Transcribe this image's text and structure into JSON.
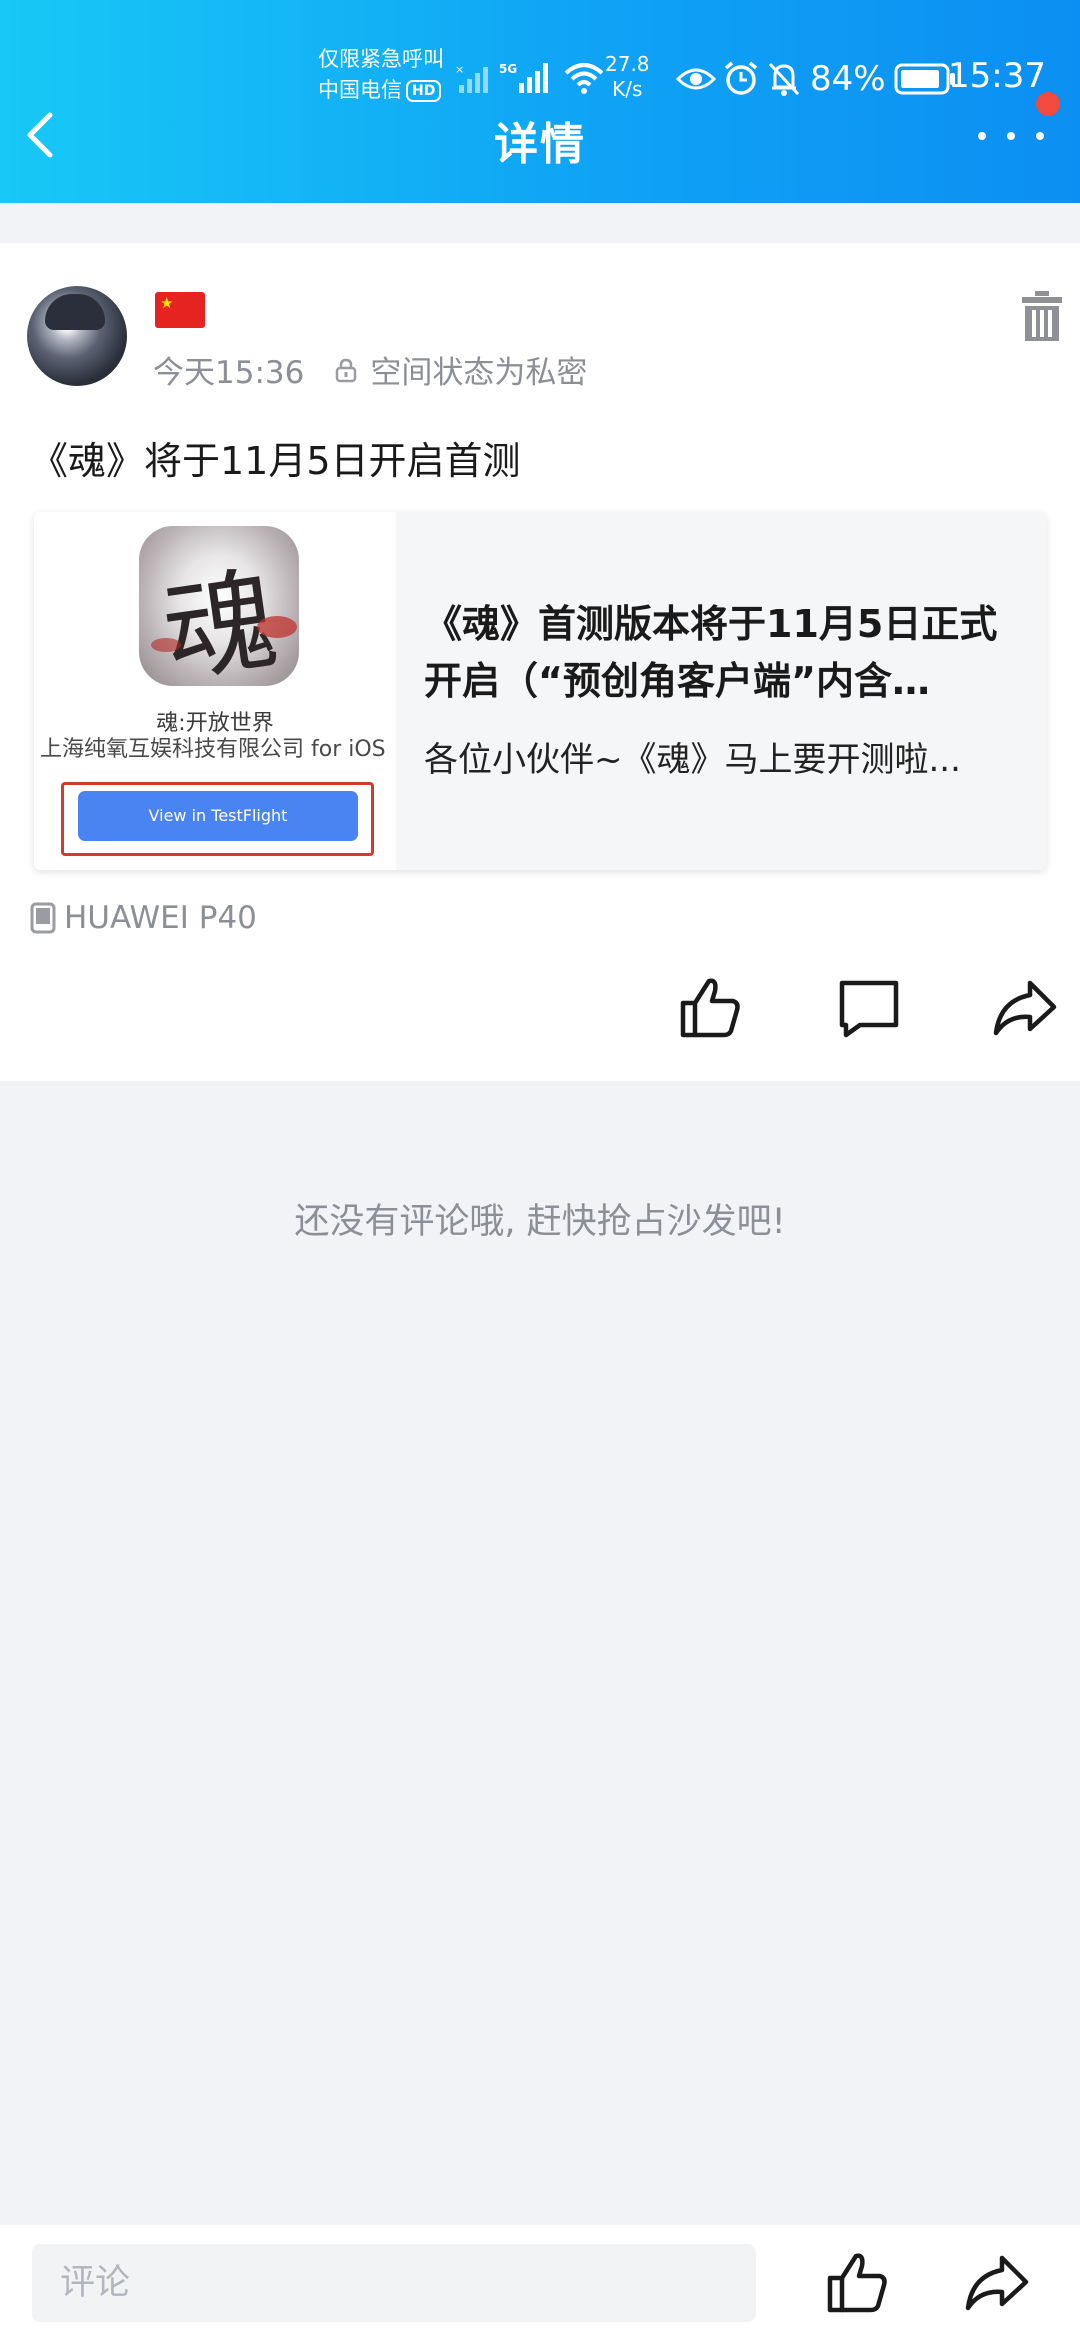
{
  "status_bar": {
    "carrier_line1": "仅限紧急呼叫",
    "carrier_line2": "中国电信",
    "hd_badge": "HD",
    "network": "5G",
    "speed_value": "27.8",
    "speed_unit": "K/s",
    "battery": "84%",
    "time": "15:37"
  },
  "header": {
    "title": "详情",
    "back_icon": "chevron-left-icon",
    "more_icon": "more-dots-icon"
  },
  "post": {
    "flag_icon": "china-flag-emoji",
    "time": "今天15:36",
    "privacy": "空间状态为私密",
    "title": "《魂》将于11月5日开启首测",
    "link_card": {
      "thumb_app_glyph": "魂",
      "thumb_app_name": "魂:开放世界",
      "thumb_company": "上海纯氧互娱科技有限公司 for iOS",
      "thumb_button": "View in TestFlight",
      "title": "《魂》首测版本将于11月5日正式开启（“预创角客户端”内含…",
      "description": "各位小伙伴~《魂》马上要开测啦..."
    },
    "device": "HUAWEI P40"
  },
  "comments": {
    "empty_text": "还没有评论哦, 赶快抢占沙发吧!"
  },
  "bottom_bar": {
    "comment_placeholder": "评论"
  },
  "colors": {
    "header_gradient_start": "#18c8f6",
    "header_gradient_end": "#0c8ff2",
    "notification_dot": "#f24a3d",
    "testflight_button": "#4a84f2"
  }
}
